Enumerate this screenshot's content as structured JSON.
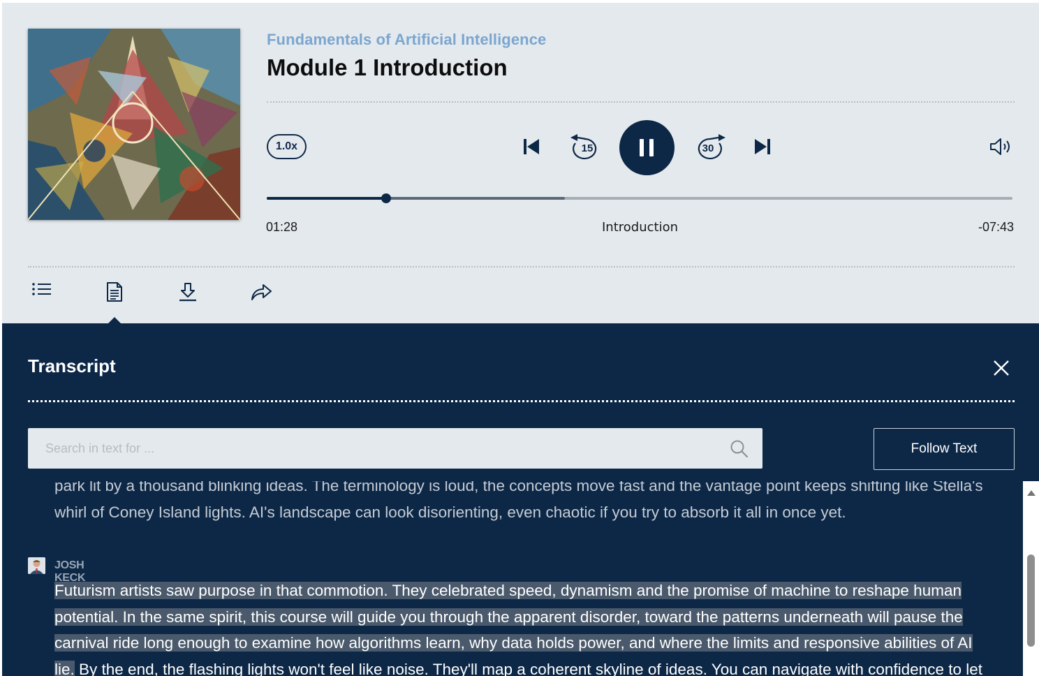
{
  "player": {
    "course_title": "Fundamentals of Artificial Intelligence",
    "module_title": "Module 1 Introduction",
    "speed": "1.0x",
    "skip_back_seconds": "15",
    "skip_forward_seconds": "30",
    "current_time": "01:28",
    "chapter": "Introduction",
    "remaining_time": "-07:43",
    "progress_played": 0.16,
    "progress_buffered": 0.4,
    "cover_image": "abstract-futurist-painting",
    "icons": [
      "previous-track-icon",
      "rewind-15-icon",
      "pause-icon",
      "forward-30-icon",
      "next-track-icon",
      "volume-icon"
    ]
  },
  "toolbar": {
    "icons": [
      "chapter-list-icon",
      "transcript-icon",
      "download-icon",
      "share-icon"
    ],
    "active": "transcript-icon"
  },
  "transcript": {
    "title": "Transcript",
    "search_placeholder": "Search in text for ...",
    "follow_label": "Follow Text",
    "paragraph_1": "park lit by a thousand blinking ideas. The terminology is loud, the concepts move fast and the vantage point keeps shifting like Stella's whirl of Coney Island lights. AI's landscape can look disorienting, even chaotic if you try to absorb it all in once yet.",
    "speaker": "JOSH KECK",
    "paragraph_2_highlighted": "Futurism artists saw purpose in that commotion. They celebrated speed, dynamism and the promise of machine to reshape human potential. In the same spirit, this course will guide you through the apparent disorder, toward the patterns underneath will pause the carnival ride long enough to examine how algorithms learn, why data holds power, and where the limits and responsive abilities of AI lie.",
    "paragraph_2_rest": " By the end, the flashing lights won't feel like noise. They'll map a coherent skyline of ideas. You can navigate with confidence to let"
  },
  "colors": {
    "navy": "#0d2847",
    "course_title": "#7ba6cf",
    "panel_bg": "#e4e9ed",
    "highlight": "#4a5a6c"
  }
}
